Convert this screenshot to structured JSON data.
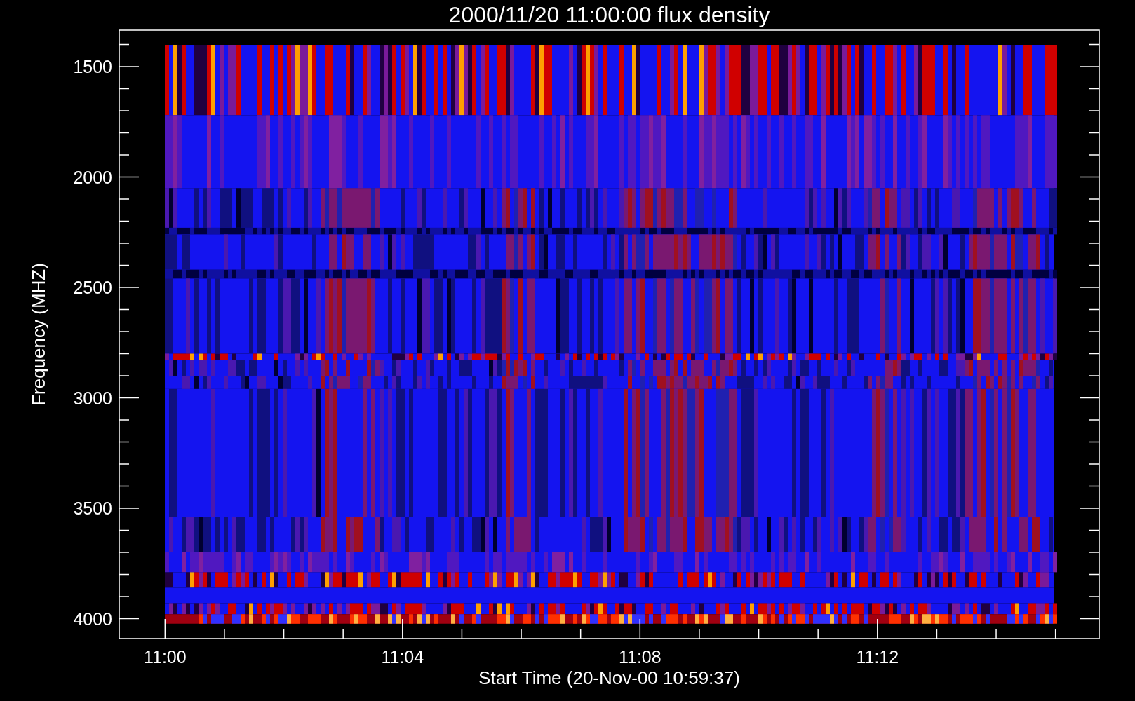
{
  "title": "2000/11/20 11:00:00 flux density",
  "y_axis": {
    "label": "Frequency (MHZ)",
    "tick_labels": [
      "1500",
      "2000",
      "2500",
      "3000",
      "3500",
      "4000"
    ]
  },
  "x_axis": {
    "label": "Start Time (20-Nov-00 10:59:37)",
    "tick_labels": [
      "11:00",
      "11:04",
      "11:08",
      "11:12"
    ]
  }
}
